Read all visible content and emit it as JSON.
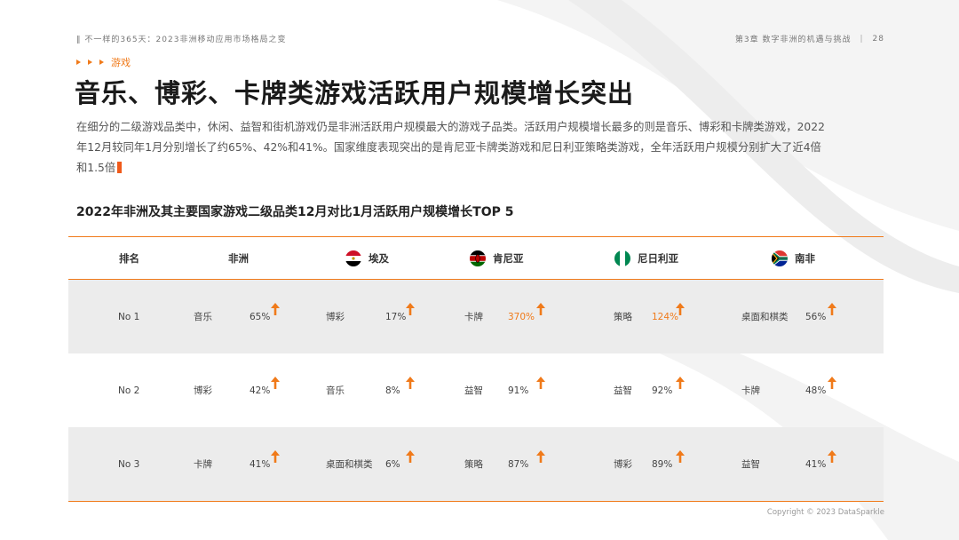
{
  "header": {
    "left": "‖ 不一样的365天：2023非洲移动应用市场格局之变",
    "right_chapter": "第3章 数字非洲的机遇与挑战",
    "right_sep": "|",
    "page_number": "28"
  },
  "section_tag": "游戏",
  "title": "音乐、博彩、卡牌类游戏活跃用户规模增长突出",
  "intro": "在细分的二级游戏品类中，休闲、益智和街机游戏仍是非洲活跃用户规模最大的游戏子品类。活跃用户规模增长最多的则是音乐、博彩和卡牌类游戏，2022年12月较同年1月分别增长了约65%、42%和41%。国家维度表现突出的是肯尼亚卡牌类游戏和尼日利亚策略类游戏，全年活跃用户规模分别扩大了近4倍和1.5倍",
  "table_title": "2022年非洲及其主要国家游戏二级品类12月对比1月活跃用户规模增长TOP 5",
  "columns": {
    "rank": "排名",
    "africa": "非洲",
    "egypt": "埃及",
    "kenya": "肯尼亚",
    "nigeria": "尼日利亚",
    "south_africa": "南非"
  },
  "rows": [
    {
      "rank": "No 1",
      "africa": {
        "cat": "音乐",
        "pct": "65%"
      },
      "egypt": {
        "cat": "博彩",
        "pct": "17%"
      },
      "kenya": {
        "cat": "卡牌",
        "pct": "370%"
      },
      "nigeria": {
        "cat": "策略",
        "pct": "124%"
      },
      "south_africa": {
        "cat": "桌面和棋类",
        "pct": "56%"
      }
    },
    {
      "rank": "No 2",
      "africa": {
        "cat": "博彩",
        "pct": "42%"
      },
      "egypt": {
        "cat": "音乐",
        "pct": "8%"
      },
      "kenya": {
        "cat": "益智",
        "pct": "91%"
      },
      "nigeria": {
        "cat": "益智",
        "pct": "92%"
      },
      "south_africa": {
        "cat": "卡牌",
        "pct": "48%"
      }
    },
    {
      "rank": "No 3",
      "africa": {
        "cat": "卡牌",
        "pct": "41%"
      },
      "egypt": {
        "cat": "桌面和棋类",
        "pct": "6%"
      },
      "kenya": {
        "cat": "策略",
        "pct": "87%"
      },
      "nigeria": {
        "cat": "博彩",
        "pct": "89%"
      },
      "south_africa": {
        "cat": "益智",
        "pct": "41%"
      }
    }
  ],
  "icons": {
    "up": "arrow-up-icon",
    "egypt_flag": "egypt-flag-icon",
    "kenya_flag": "kenya-flag-icon",
    "nigeria_flag": "nigeria-flag-icon",
    "south_africa_flag": "south-africa-flag-icon"
  },
  "colors": {
    "accent": "#f07a1a",
    "highlight_text": "#f07a1a"
  },
  "copyright": "Copyright © 2023 DataSparkle"
}
